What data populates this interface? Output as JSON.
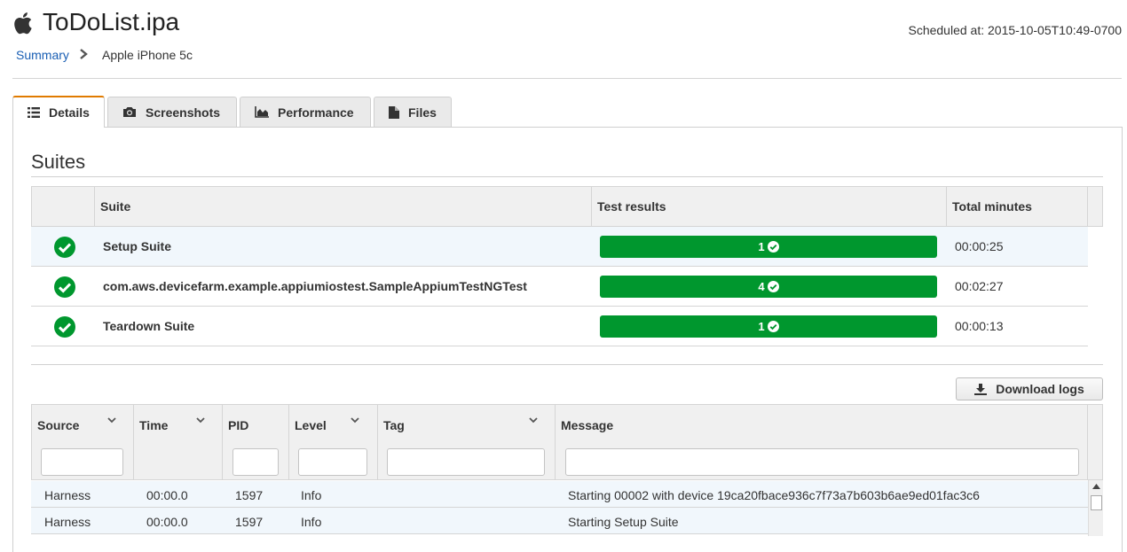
{
  "header": {
    "app_title": "ToDoList.ipa",
    "scheduled": "Scheduled at: 2015-10-05T10:49-0700",
    "breadcrumb": {
      "link": "Summary",
      "current": "Apple iPhone 5c"
    }
  },
  "tabs": [
    {
      "label": "Details",
      "icon": "list-icon",
      "active": true
    },
    {
      "label": "Screenshots",
      "icon": "camera-icon",
      "active": false
    },
    {
      "label": "Performance",
      "icon": "area-chart-icon",
      "active": false
    },
    {
      "label": "Files",
      "icon": "file-icon",
      "active": false
    }
  ],
  "suites": {
    "title": "Suites",
    "columns": {
      "suite": "Suite",
      "results": "Test results",
      "minutes": "Total minutes"
    },
    "rows": [
      {
        "name": "Setup Suite",
        "result": "1",
        "minutes": "00:00:25",
        "status": "passed"
      },
      {
        "name": "com.aws.devicefarm.example.appiumiostest.SampleAppiumTestNGTest",
        "result": "4",
        "minutes": "00:02:27",
        "status": "passed"
      },
      {
        "name": "Teardown Suite",
        "result": "1",
        "minutes": "00:00:13",
        "status": "passed"
      }
    ]
  },
  "logs": {
    "download_label": "Download logs",
    "columns": {
      "source": "Source",
      "time": "Time",
      "pid": "PID",
      "level": "Level",
      "tag": "Tag",
      "message": "Message"
    },
    "rows": [
      {
        "source": "Harness",
        "time": "00:00.0",
        "pid": "1597",
        "level": "Info",
        "tag": "",
        "message": "Starting 00002 with device 19ca20fbace936c7f73a7b603b6ae9ed01fac3c6"
      },
      {
        "source": "Harness",
        "time": "00:00.0",
        "pid": "1597",
        "level": "Info",
        "tag": "",
        "message": "Starting Setup Suite"
      }
    ]
  },
  "colors": {
    "accent": "#e07b00",
    "success": "#00972e",
    "link": "#1a5fb4"
  }
}
